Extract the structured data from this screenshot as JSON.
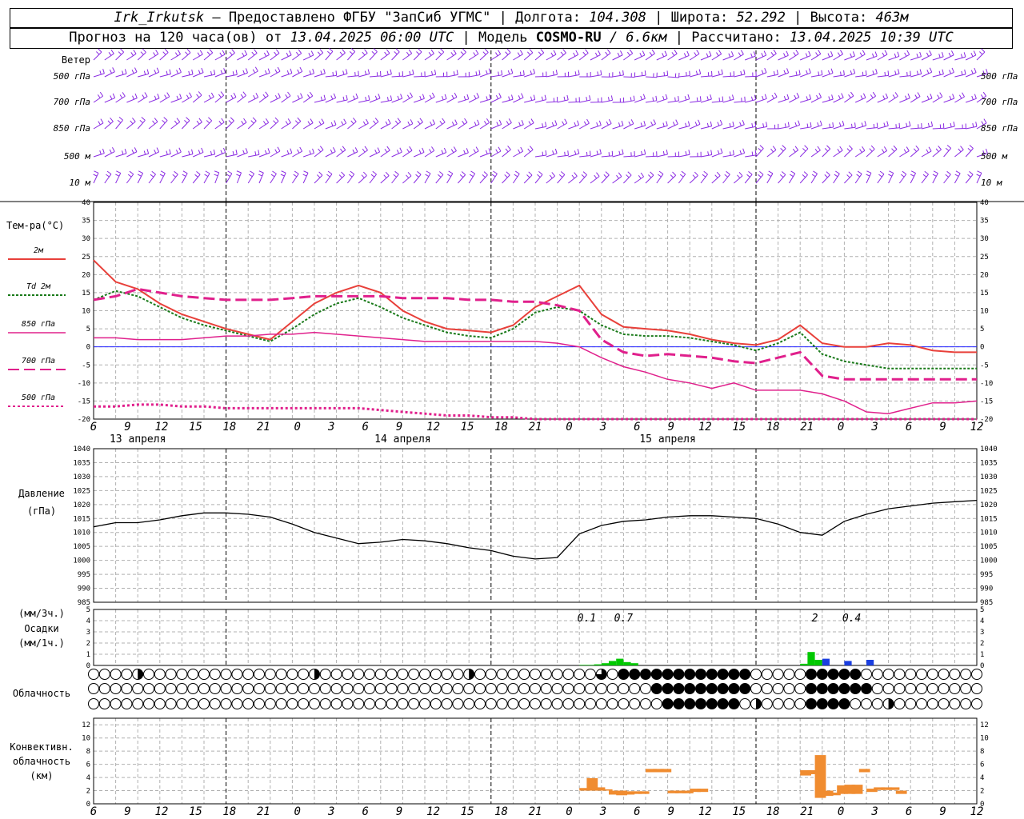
{
  "header": {
    "station": "Irk_Irkutsk",
    "provider": "— Предоставлено ФГБУ \"ЗапСиб УГМС\"",
    "lon_label": "Долгота:",
    "lon": "104.308",
    "lat_label": "Широта:",
    "lat": "52.292",
    "alt_label": "Высота:",
    "alt": "463м",
    "forecast_label": "Прогноз на 120 часа(ов) от",
    "forecast_start": "13.04.2025 06:00 UTC",
    "model_label": "Модель",
    "model": "COSMO-RU",
    "resolution": "/ 6.6км",
    "computed_label": "Рассчитано:",
    "computed": "13.04.2025 10:39 UTC"
  },
  "panels": {
    "wind": {
      "title": "Ветер",
      "levels": [
        "500 гПа",
        "700 гПа",
        "850 гПа",
        "500 м",
        "10 м"
      ]
    },
    "temp": {
      "title": "Тем-ра(°С)",
      "legend": [
        {
          "label": "2м",
          "color": "#e8403a",
          "dash": "",
          "width": 2
        },
        {
          "label": "Td 2м",
          "color": "#1a7a1a",
          "dash": "3,2",
          "width": 2
        },
        {
          "label": "850 гПа",
          "color": "#e0208c",
          "dash": "",
          "width": 1.5
        },
        {
          "label": "700 гПа",
          "color": "#e0208c",
          "dash": "14,6",
          "width": 3
        },
        {
          "label": "500 гПа",
          "color": "#e0208c",
          "dash": "3,3",
          "width": 3
        }
      ]
    },
    "pressure": {
      "title": "Давление",
      "units": "(гПа)"
    },
    "precip": {
      "units_top": "(мм/3ч.)",
      "title": "Осадки",
      "units_bottom": "(мм/1ч.)",
      "labels": [
        "0.1",
        "0.7",
        "2",
        "0.4"
      ]
    },
    "cloud": {
      "title": "Облачность"
    },
    "conv": {
      "title": [
        "Конвективн.",
        "облачность",
        "(км)"
      ]
    }
  },
  "time_axis": {
    "hour_labels": [
      "6",
      "9",
      "12",
      "15",
      "18",
      "21",
      "0",
      "3",
      "6",
      "9",
      "12",
      "15",
      "18",
      "21",
      "0",
      "3",
      "6",
      "9",
      "12",
      "15",
      "18",
      "21",
      "0",
      "3",
      "6",
      "9",
      "12"
    ],
    "day_labels": [
      "13 апреля",
      "14 апреля",
      "15 апреля"
    ]
  },
  "chart_data": [
    {
      "type": "line",
      "title": "Тем-ра(°С)",
      "x_unit": "hours from 13.04.2025 06:00 UTC",
      "ylim": [
        -20,
        40
      ],
      "yticks": [
        -20,
        -15,
        -10,
        -5,
        0,
        5,
        10,
        15,
        20,
        25,
        30,
        35,
        40
      ],
      "grid": true,
      "x": [
        0,
        3,
        6,
        9,
        12,
        15,
        18,
        21,
        24,
        27,
        30,
        33,
        36,
        39,
        42,
        45,
        48,
        51,
        54,
        57,
        60,
        63,
        66,
        69,
        72,
        75,
        78,
        81,
        84,
        87,
        90,
        93,
        96,
        99,
        102,
        105,
        108,
        111,
        114,
        117,
        120
      ],
      "series": [
        {
          "name": "2м",
          "values": [
            24,
            18,
            16,
            12,
            9,
            7,
            5,
            3.5,
            2,
            7,
            12,
            15,
            17,
            15,
            10,
            7,
            5,
            4.5,
            4,
            6,
            11,
            14,
            17,
            9,
            5.5,
            5,
            4.5,
            3.5,
            2,
            1,
            0.5,
            2,
            6,
            1,
            0,
            0,
            1,
            0.5,
            -1,
            -1.5,
            -1.5
          ]
        },
        {
          "name": "Td 2м",
          "values": [
            13,
            15.5,
            14,
            11,
            8,
            6,
            4.5,
            3,
            1.5,
            5,
            9,
            12,
            13.5,
            11,
            8,
            6,
            4,
            3,
            2.5,
            5,
            9.5,
            11,
            10,
            6,
            3.5,
            3,
            3,
            2.5,
            1.5,
            0.5,
            -1,
            1,
            4,
            -2,
            -4,
            -5,
            -6,
            -6,
            -6,
            -6,
            -6
          ]
        },
        {
          "name": "850 гПа",
          "values": [
            2.5,
            2.5,
            2,
            2,
            2,
            2.5,
            3,
            3,
            3.5,
            3.5,
            4,
            3.5,
            3,
            2.5,
            2,
            1.5,
            1.5,
            1.5,
            1.5,
            1.5,
            1.5,
            1,
            0,
            -3,
            -5.5,
            -7,
            -9,
            -10,
            -11.5,
            -10,
            -12,
            -12,
            -12,
            -13,
            -15,
            -18,
            -18.5,
            -17,
            -15.5,
            -15.5,
            -15
          ]
        },
        {
          "name": "700 гПа",
          "values": [
            13,
            14,
            16,
            15,
            14,
            13.5,
            13,
            13,
            13,
            13.5,
            14,
            14,
            14,
            14,
            13.5,
            13.5,
            13.5,
            13,
            13,
            12.5,
            12.5,
            11.5,
            10,
            2,
            -1.5,
            -2.5,
            -2,
            -2.5,
            -3,
            -4,
            -4.5,
            -3,
            -1.5,
            -8,
            -9,
            -9,
            -9,
            -9,
            -9,
            -9,
            -9
          ]
        },
        {
          "name": "500 гПа",
          "values": [
            -16.5,
            -16.5,
            -16,
            -16,
            -16.5,
            -16.5,
            -17,
            -17,
            -17,
            -17,
            -17,
            -17,
            -17,
            -17.5,
            -18,
            -18.5,
            -19,
            -19,
            -19.5,
            -19.5,
            -20,
            -20,
            -20,
            -20,
            -20,
            -20,
            -20,
            -20,
            -20,
            -20,
            -20,
            -20,
            -20,
            -20,
            -20,
            -20,
            -20,
            -20,
            -20,
            -20,
            -20
          ]
        }
      ]
    },
    {
      "type": "line",
      "title": "Давление",
      "ylabel": "(гПа)",
      "ylim": [
        985,
        1040
      ],
      "yticks": [
        985,
        990,
        995,
        1000,
        1005,
        1010,
        1015,
        1020,
        1025,
        1030,
        1035,
        1040
      ],
      "x": [
        0,
        3,
        6,
        9,
        12,
        15,
        18,
        21,
        24,
        27,
        30,
        33,
        36,
        39,
        42,
        45,
        48,
        51,
        54,
        57,
        60,
        63,
        66,
        69,
        72,
        75,
        78,
        81,
        84,
        87,
        90,
        93,
        96,
        99,
        102,
        105,
        108,
        111,
        114,
        117,
        120
      ],
      "series": [
        {
          "name": "Давление",
          "values": [
            1012,
            1013.5,
            1013.5,
            1014.5,
            1016,
            1017,
            1017,
            1016.5,
            1015.5,
            1013,
            1010,
            1008,
            1006,
            1006.5,
            1007.5,
            1007,
            1006,
            1004.5,
            1003.5,
            1001.5,
            1000.5,
            1001,
            1009.5,
            1012.5,
            1014,
            1014.5,
            1015.5,
            1016,
            1016,
            1015.5,
            1015,
            1013,
            1010,
            1009,
            1014,
            1016.5,
            1018.5,
            1019.5,
            1020.5,
            1021,
            1021.5
          ]
        }
      ]
    },
    {
      "type": "bar",
      "title": "Осадки",
      "ylim": [
        0,
        5
      ],
      "yticks": [
        0,
        1,
        2,
        3,
        4,
        5
      ],
      "series": [
        {
          "name": "мм/1ч.",
          "color": "#00c800",
          "x": [
            66,
            67,
            68,
            69,
            70,
            71,
            72,
            73,
            96,
            97,
            98
          ],
          "values": [
            0.05,
            0.05,
            0.1,
            0.2,
            0.4,
            0.6,
            0.3,
            0.2,
            0.15,
            1.2,
            0.5
          ]
        },
        {
          "name": "мм/3ч.",
          "color": "#1a3ee0",
          "x": [
            99,
            102,
            105
          ],
          "values": [
            0.6,
            0.4,
            0.5
          ]
        }
      ]
    },
    {
      "type": "bar",
      "title": "Конвективн. облачность (км)",
      "ylim": [
        0,
        13
      ],
      "yticks": [
        0,
        2,
        4,
        6,
        8,
        10,
        12
      ],
      "series": [
        {
          "name": "conv",
          "color": "#f08c30",
          "segments": [
            [
              66,
              2,
              2.4
            ],
            [
              67,
              2,
              3.9
            ],
            [
              68,
              2,
              2.5
            ],
            [
              69,
              2,
              2.2
            ],
            [
              70,
              1.4,
              2
            ],
            [
              71,
              1.3,
              2
            ],
            [
              72,
              1.4,
              1.9
            ],
            [
              73,
              1.5,
              1.9
            ],
            [
              74,
              1.5,
              1.9
            ],
            [
              75,
              4.8,
              5.3
            ],
            [
              76,
              4.8,
              5.3
            ],
            [
              77,
              4.8,
              5.3
            ],
            [
              78,
              1.6,
              2
            ],
            [
              79,
              1.6,
              2
            ],
            [
              80,
              1.6,
              2
            ],
            [
              81,
              1.8,
              2.3
            ],
            [
              82,
              1.8,
              2.3
            ],
            [
              96,
              4.3,
              5.1
            ],
            [
              97,
              4.5,
              5.1
            ],
            [
              98,
              0.9,
              7.4
            ],
            [
              99,
              1.2,
              2
            ],
            [
              100,
              1.3,
              1.7
            ],
            [
              101,
              1.5,
              2.8
            ],
            [
              102,
              1.5,
              2.9
            ],
            [
              103,
              1.5,
              2.9
            ],
            [
              104,
              4.8,
              5.3
            ],
            [
              105,
              1.8,
              2.3
            ],
            [
              106,
              2.1,
              2.5
            ],
            [
              107,
              2.1,
              2.5
            ],
            [
              108,
              2.1,
              2.5
            ],
            [
              109,
              1.5,
              2
            ]
          ]
        }
      ]
    }
  ]
}
